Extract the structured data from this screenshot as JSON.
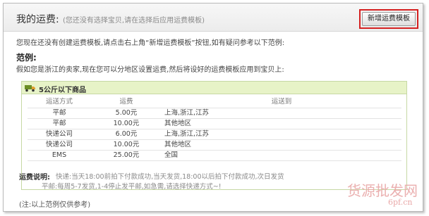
{
  "header": {
    "title": "我的运费:",
    "subtitle": "(您还没有选择宝贝,请在选择后应用运费模板)",
    "add_button": "新增运费模板"
  },
  "intro": "您现在还没有创建运费模板,请点击右上角“新增运费模板”按钮,如有疑问参考以下范例:",
  "example": {
    "title": "范例:",
    "description": "假如您是浙江的卖家,现在您可以分地区设置运费,然后将设好的运费模板应用到宝贝上:"
  },
  "panel": {
    "title": "5公斤以下商品",
    "icon": "truck-icon",
    "headers": [
      "运送方式",
      "运费",
      "运送到"
    ],
    "rows": [
      {
        "method": "平邮",
        "fee": "5.00元",
        "dest": "上海,浙江,江苏"
      },
      {
        "method": "平邮",
        "fee": "10.00元",
        "dest": "其他地区"
      },
      {
        "method": "快递公司",
        "fee": "6.00元",
        "dest": "上海,浙江,江苏"
      },
      {
        "method": "快递公司",
        "fee": "10.00元",
        "dest": "其他地区"
      },
      {
        "method": "EMS",
        "fee": "25.00元",
        "dest": "全国"
      }
    ],
    "note_label": "运费说明:",
    "note_line1": "快递:当天18:00前拍下付款成功,当天发货,18:00以后拍下付款成功,次日发货",
    "note_line2": "平邮:每周5-7发货,1-4停止发平邮,如急需,请选择快递方式~!"
  },
  "footer": "(注:以上范例仅供参考)",
  "watermark": {
    "line1": "货源批发网",
    "line2": "6pf.cn"
  },
  "colors": {
    "highlight_border": "#d42020",
    "panel_head": "#e7f3c7",
    "panel_border": "#c6d8a4"
  }
}
